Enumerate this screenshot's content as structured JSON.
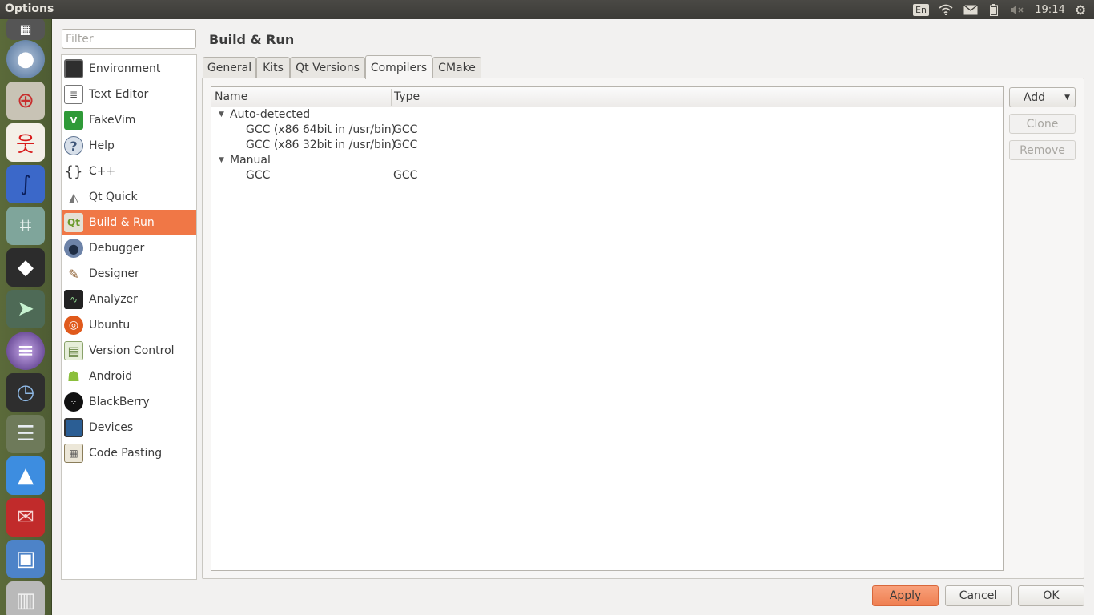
{
  "window": {
    "title": "Options"
  },
  "tray": {
    "keyboard": "En",
    "clock": "19:14"
  },
  "filter": {
    "placeholder": "Filter"
  },
  "nav": {
    "items": [
      {
        "label": "Environment"
      },
      {
        "label": "Text Editor"
      },
      {
        "label": "FakeVim"
      },
      {
        "label": "Help"
      },
      {
        "label": "C++"
      },
      {
        "label": "Qt Quick"
      },
      {
        "label": "Build & Run"
      },
      {
        "label": "Debugger"
      },
      {
        "label": "Designer"
      },
      {
        "label": "Analyzer"
      },
      {
        "label": "Ubuntu"
      },
      {
        "label": "Version Control"
      },
      {
        "label": "Android"
      },
      {
        "label": "BlackBerry"
      },
      {
        "label": "Devices"
      },
      {
        "label": "Code Pasting"
      }
    ],
    "selected": "Build & Run"
  },
  "page": {
    "title": "Build & Run",
    "tabs": [
      "General",
      "Kits",
      "Qt Versions",
      "Compilers",
      "CMake"
    ],
    "active_tab": "Compilers"
  },
  "tree": {
    "headers": {
      "name": "Name",
      "type": "Type"
    },
    "groups": [
      {
        "label": "Auto-detected",
        "items": [
          {
            "name": "GCC (x86 64bit in /usr/bin)",
            "type": "GCC"
          },
          {
            "name": "GCC (x86 32bit in /usr/bin)",
            "type": "GCC"
          }
        ]
      },
      {
        "label": "Manual",
        "items": [
          {
            "name": "GCC",
            "type": "GCC"
          }
        ]
      }
    ]
  },
  "actions": {
    "add": "Add",
    "clone": "Clone",
    "remove": "Remove"
  },
  "dialog": {
    "apply": "Apply",
    "cancel": "Cancel",
    "ok": "OK"
  },
  "colors": {
    "accent": "#f07746",
    "panel": "#3c3b37",
    "launcher": "#5b6a3a"
  }
}
